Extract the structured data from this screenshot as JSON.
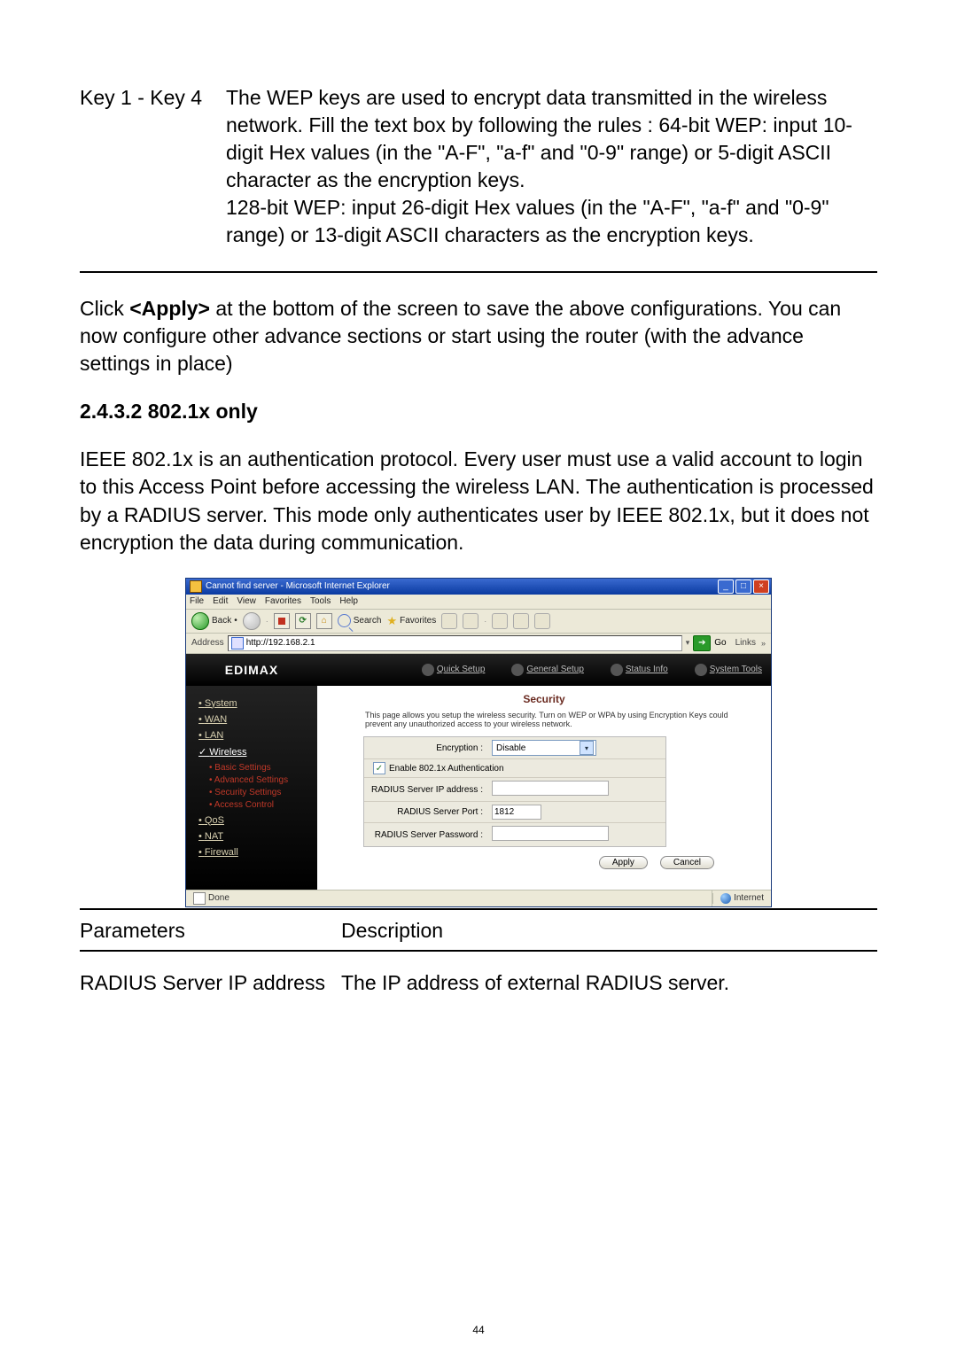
{
  "top_table": {
    "param": "Key 1 - Key 4",
    "desc": "The WEP keys are used to encrypt data transmitted in the wireless network. Fill the text box by following the rules : 64-bit WEP: input 10-digit Hex values (in the \"A-F\", \"a-f\" and \"0-9\" range) or 5-digit ASCII character as the encryption keys.\n128-bit WEP: input 26-digit Hex values (in the \"A-F\", \"a-f\" and \"0-9\" range) or 13-digit ASCII characters as the encryption keys."
  },
  "apply_para_pre": "Click ",
  "apply_bold": "<Apply>",
  "apply_para_post": " at the bottom of the screen to save the above configurations. You can now configure other advance sections or start using the router (with the advance settings in place)",
  "section_heading": "2.4.3.2 802.1x only",
  "section_body": "IEEE 802.1x is an authentication protocol. Every user must use a valid account to login to this Access Point before accessing the wireless LAN. The authentication is processed by a RADIUS server. This mode only authenticates user by IEEE 802.1x, but it does not encryption the data during communication.",
  "window": {
    "title": "Cannot find server - Microsoft Internet Explorer",
    "menus": [
      "File",
      "Edit",
      "View",
      "Favorites",
      "Tools",
      "Help"
    ],
    "back": "Back",
    "search": "Search",
    "favorites": "Favorites",
    "address_label": "Address",
    "url": "http://192.168.2.1",
    "go": "Go",
    "links": "Links",
    "brand": "EDIMAX",
    "topnav": [
      "Quick Setup",
      "General Setup",
      "Status Info",
      "System Tools"
    ],
    "side": {
      "system": "System",
      "wan": "WAN",
      "lan": "LAN",
      "wireless": "Wireless",
      "sub": [
        "Basic Settings",
        "Advanced Settings",
        "Security Settings",
        "Access Control"
      ],
      "qos": "QoS",
      "nat": "NAT",
      "firewall": "Firewall"
    },
    "panel": {
      "title": "Security",
      "desc": "This page allows you setup the wireless security. Turn on WEP or WPA by using Encryption Keys could prevent any unauthorized access to your wireless network.",
      "enc_label": "Encryption :",
      "enc_value": "Disable",
      "auth_label": "Enable 802.1x Authentication",
      "ip_label": "RADIUS Server IP address :",
      "port_label": "RADIUS Server Port :",
      "port_value": "1812",
      "pw_label": "RADIUS Server Password :",
      "apply": "Apply",
      "cancel": "Cancel"
    },
    "status_done": "Done",
    "status_zone": "Internet"
  },
  "btable": {
    "h1": "Parameters",
    "h2": "Description",
    "r1c1": "RADIUS Server IP address",
    "r1c2": "The IP address of external RADIUS server."
  },
  "page_number": "44"
}
